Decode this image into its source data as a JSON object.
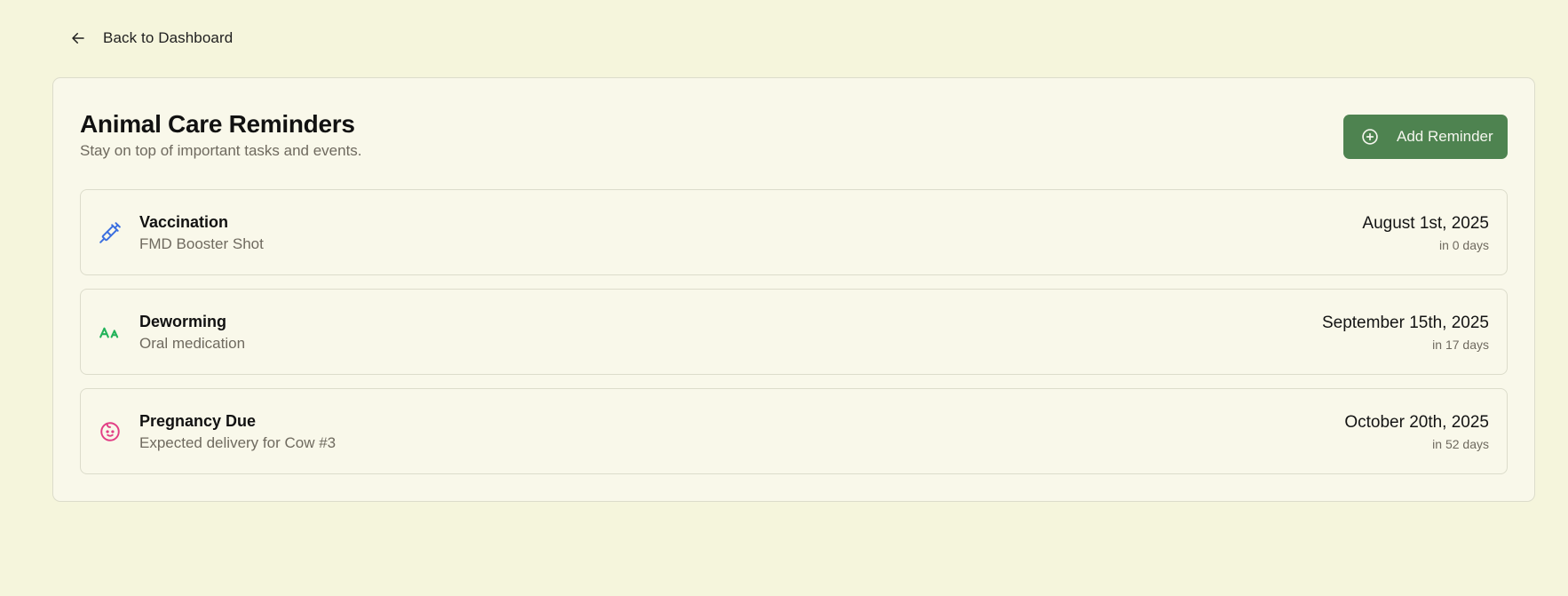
{
  "nav": {
    "back_label": "Back to Dashboard",
    "back_icon": "arrow-left-icon"
  },
  "card": {
    "title": "Animal Care Reminders",
    "subtitle": "Stay on top of important tasks and events.",
    "add_button_label": "Add Reminder",
    "add_button_icon": "plus-circle-icon"
  },
  "reminders": [
    {
      "title": "Vaccination",
      "description": "FMD Booster Shot",
      "date": "August 1st, 2025",
      "relative": "in 0 days",
      "icon": "syringe-icon",
      "icon_color": "#3b6fe0"
    },
    {
      "title": "Deworming",
      "description": "Oral medication",
      "date": "September 15th, 2025",
      "relative": "in 17 days",
      "icon": "text-size-icon",
      "icon_color": "#22b35a"
    },
    {
      "title": "Pregnancy Due",
      "description": "Expected delivery for Cow #3",
      "date": "October 20th, 2025",
      "relative": "in 52 days",
      "icon": "baby-icon",
      "icon_color": "#e23e85"
    }
  ],
  "colors": {
    "background": "#f5f5dc",
    "card_background": "#f9f8ea",
    "accent": "#4e8350"
  }
}
